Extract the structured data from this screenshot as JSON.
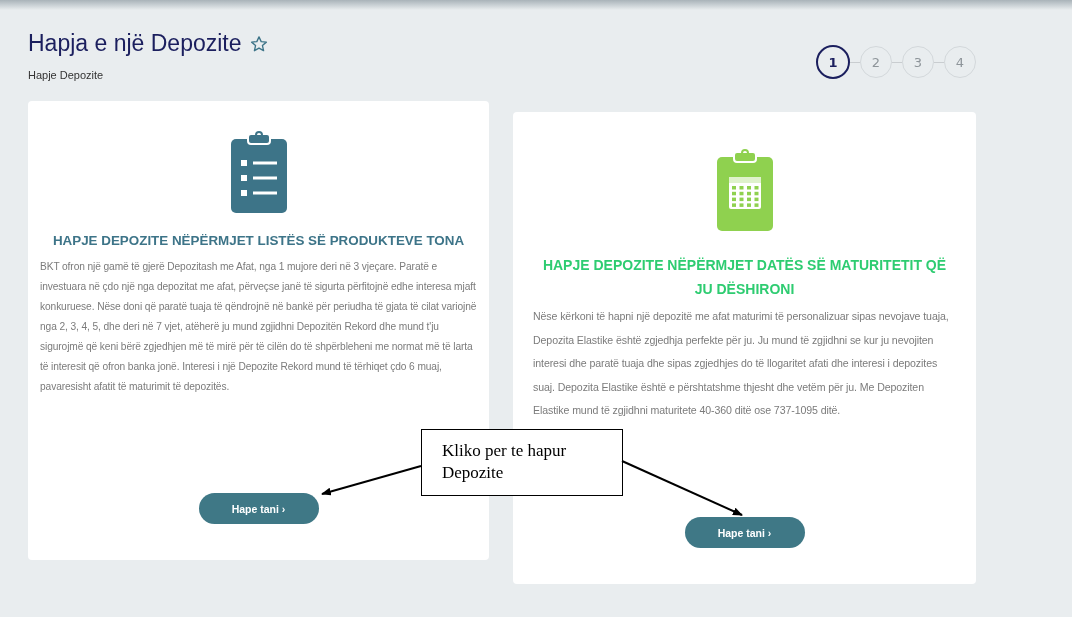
{
  "header": {
    "title": "Hapja e një Depozite",
    "breadcrumb": "Hapje Depozite"
  },
  "steps": [
    {
      "label": "1",
      "selected": true
    },
    {
      "label": "2",
      "selected": false
    },
    {
      "label": "3",
      "selected": false
    },
    {
      "label": "4",
      "selected": false
    }
  ],
  "cards": [
    {
      "kind": "list",
      "color": "#3d7488",
      "title": "HAPJE DEPOZITE NËPËRMJET LISTËS SË PRODUKTEVE TONA",
      "text": "BKT ofron një gamë të gjerë Depozitash me Afat, nga 1 mujore deri në 3 vjeçare. Paratë e investuara në çdo një nga depozitat me afat, përveçse janë të sigurta përfitojnë edhe interesa mjaft konkuruese. Nëse doni që paratë tuaja të qëndrojnë në bankë për periudha të gjata të cilat variojnë nga 2, 3, 4, 5, dhe deri në 7 vjet, atëherë ju mund zgjidhni Depozitën Rekord dhe mund t'ju sigurojmë që keni bërë zgjedhjen më të mirë për të cilën do të shpërbleheni me normat më të larta të interesit që ofron banka jonë. Interesi i një Depozite Rekord mund të tërhiqet çdo 6 muaj, pavaresisht afatit të maturimit të depozitës.",
      "button": "Hape tani ›"
    },
    {
      "kind": "calendar",
      "color": "#2ecc71",
      "title": "HAPJE DEPOZITE NËPËRMJET DATËS SË MATURITETIT QË JU DËSHIRONI",
      "text": "Nëse kërkoni të hapni një depozitë me afat maturimi të personalizuar sipas nevojave tuaja, Depozita Elastike është zgjedhja perfekte për ju. Ju mund të zgjidhni se kur ju nevojiten interesi dhe paratë tuaja dhe sipas zgjedhjes do të llogaritet afati dhe interesi i depozites suaj. Depozita Elastike është e përshtatshme thjesht dhe vetëm për ju. Me Depoziten Elastike mund të zgjidhni maturitete 40-360 ditë ose 737-1095 ditë.",
      "button": "Hape tani ›"
    }
  ],
  "callout": {
    "text": "Kliko per te hapur Depozite"
  }
}
